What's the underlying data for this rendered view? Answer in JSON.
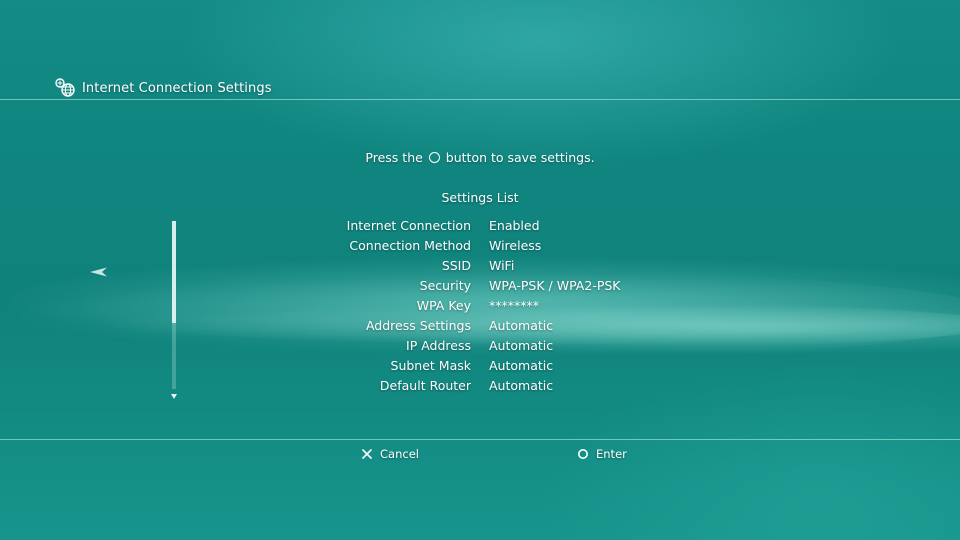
{
  "header": {
    "title": "Internet Connection Settings",
    "icon": "network-settings-icon"
  },
  "instruction": {
    "before": "Press the",
    "button_glyph": "circle-button-icon",
    "after": "button to save settings."
  },
  "settings_list": {
    "title": "Settings List",
    "items": [
      {
        "label": "Internet Connection",
        "value": "Enabled"
      },
      {
        "label": "Connection Method",
        "value": "Wireless"
      },
      {
        "label": "SSID",
        "value": "WiFi"
      },
      {
        "label": "Security",
        "value": "WPA-PSK / WPA2-PSK"
      },
      {
        "label": "WPA Key",
        "value": "********"
      },
      {
        "label": "Address Settings",
        "value": "Automatic"
      },
      {
        "label": "IP Address",
        "value": "Automatic"
      },
      {
        "label": "Subnet Mask",
        "value": "Automatic"
      },
      {
        "label": "Default Router",
        "value": "Automatic"
      }
    ]
  },
  "scroll": {
    "position_fraction": 0.0,
    "visible_fraction": 0.61
  },
  "footer": {
    "cancel_label": "Cancel",
    "cancel_icon": "cross-button-icon",
    "enter_label": "Enter",
    "enter_icon": "circle-button-icon"
  },
  "colors": {
    "background": "#10857f",
    "text": "#ffffff",
    "rule": "#c8f0eb"
  }
}
